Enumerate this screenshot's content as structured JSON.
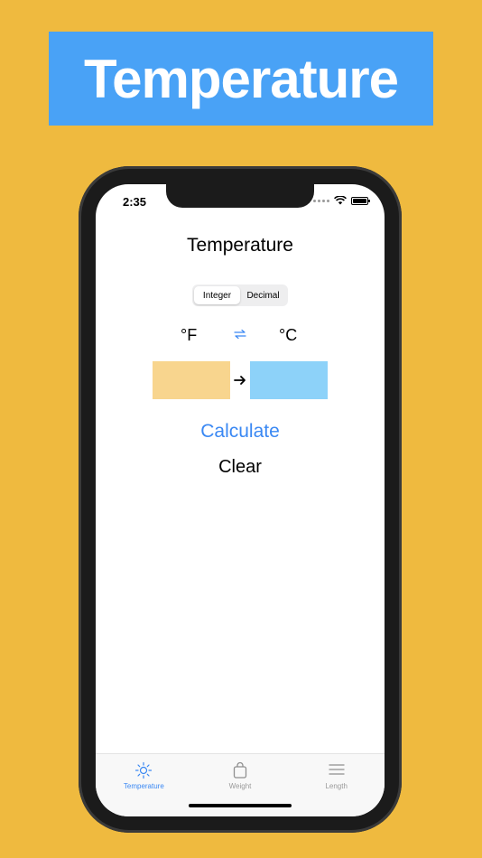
{
  "banner": {
    "title": "Temperature"
  },
  "status_bar": {
    "time": "2:35"
  },
  "screen": {
    "title": "Temperature",
    "segments": [
      "Integer",
      "Decimal"
    ],
    "selected_segment": "Integer",
    "unit_from": "°F",
    "unit_to": "°C",
    "calculate_label": "Calculate",
    "clear_label": "Clear"
  },
  "tabbar": {
    "items": [
      {
        "label": "Temperature",
        "icon": "sun-icon",
        "active": true
      },
      {
        "label": "Weight",
        "icon": "bag-icon",
        "active": false
      },
      {
        "label": "Length",
        "icon": "lines-icon",
        "active": false
      }
    ]
  },
  "colors": {
    "background": "#efba3f",
    "banner": "#49a2f6",
    "accent": "#3a88f3",
    "input_box": "#f8d58e",
    "output_box": "#8dd2f9"
  }
}
